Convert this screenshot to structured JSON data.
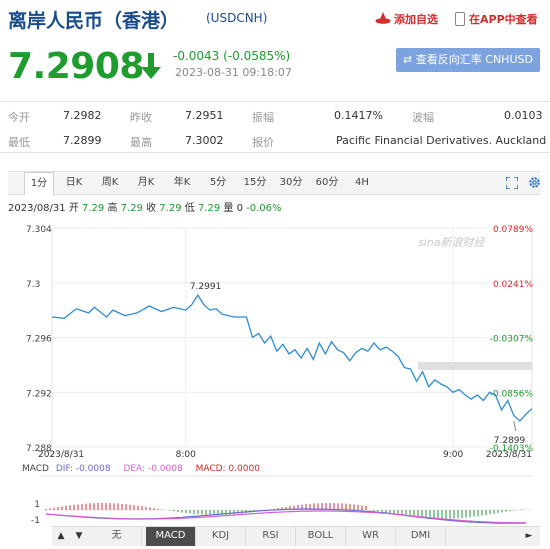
{
  "header": {
    "title": "离岸人民币（香港）",
    "code": "(USDCNH)",
    "add_fav_label": "添加自选",
    "app_view_label": "在APP中查看"
  },
  "quote": {
    "price": "7.2908",
    "change": "-0.0043 (-0.0585%)",
    "timestamp": "2023-08-31 09:18:07",
    "convert_label": "查看反向汇率 CNHUSD"
  },
  "stats": {
    "open_label": "今开",
    "open_value": "7.2982",
    "prev_close_label": "昨收",
    "prev_close_value": "7.2951",
    "amplitude_label": "振幅",
    "amplitude_value": "0.1417%",
    "volatility_label": "波幅",
    "volatility_value": "0.0103",
    "low_label": "最低",
    "low_value": "7.2899",
    "high_label": "最高",
    "high_value": "7.3002",
    "quoter_label": "报价",
    "quoter_value": "Pacific Financial Derivatives. Auckland"
  },
  "period_tabs": [
    "1分",
    "日K",
    "周K",
    "月K",
    "年K",
    "5分",
    "15分",
    "30分",
    "60分",
    "4H"
  ],
  "quote_line": {
    "date": "2023/08/31",
    "open_label": "开",
    "open": "7.29",
    "high_label": "高",
    "high": "7.29",
    "close_label": "收",
    "close": "7.29",
    "low_label": "低",
    "low": "7.29",
    "vol_label": "量",
    "vol": "0",
    "change": "-0.06%"
  },
  "macd": {
    "label": "MACD",
    "dif": "DIF: -0.0008",
    "dea": "DEA: -0.0008",
    "macd": "MACD: 0.0000"
  },
  "indicator_tabs": [
    "无",
    "MACD",
    "KDJ",
    "RSI",
    "BOLL",
    "WR",
    "DMI"
  ],
  "watermark": "sina新浪财经",
  "colors": {
    "up": "#d62c2c",
    "down": "#1e9c2e",
    "title": "#1a4c8c",
    "line": "#2e8bd6",
    "button": "#7da3de"
  },
  "chart_data": {
    "type": "line",
    "y_ticks": [
      "7.304",
      "7.3",
      "7.296",
      "7.292",
      "7.288"
    ],
    "y_range": [
      7.288,
      7.304
    ],
    "pct_ticks": [
      "0.0789%",
      "0.0241%",
      "-0.0307%",
      "-0.0856%",
      "-0.1403%"
    ],
    "x_ticks": [
      "2023/8/31",
      "8:00",
      "9:00",
      "2023/8/31"
    ],
    "annotations": [
      {
        "label": "7.2991",
        "x": 48,
        "y": 7.2991
      },
      {
        "label": "7.2899",
        "x": 152,
        "y": 7.2899
      }
    ],
    "x": [
      0,
      4,
      8,
      12,
      14,
      18,
      20,
      24,
      28,
      32,
      36,
      40,
      44,
      46,
      48,
      50,
      52,
      54,
      56,
      60,
      64,
      66,
      68,
      70,
      72,
      74,
      76,
      78,
      80,
      82,
      84,
      86,
      88,
      90,
      92,
      94,
      96,
      98,
      100,
      102,
      104,
      106,
      108,
      110,
      112,
      114,
      116,
      118,
      120,
      122,
      124,
      126,
      128,
      130,
      132,
      134,
      136,
      138,
      140,
      142,
      144,
      146,
      148,
      150,
      152,
      154,
      156,
      158
    ],
    "y": [
      7.2975,
      7.2974,
      7.2981,
      7.2978,
      7.2982,
      7.2975,
      7.298,
      7.2976,
      7.2978,
      7.2983,
      7.2979,
      7.2982,
      7.298,
      7.2984,
      7.2991,
      7.2984,
      7.298,
      7.2981,
      7.2977,
      7.2975,
      7.2975,
      7.296,
      7.2963,
      7.2956,
      7.2961,
      7.295,
      7.2955,
      7.2948,
      7.2951,
      7.2945,
      7.2952,
      7.2944,
      7.2956,
      7.2948,
      7.2957,
      7.2951,
      7.2949,
      7.2943,
      7.2949,
      7.2952,
      7.295,
      7.2956,
      7.2951,
      7.2953,
      7.295,
      7.2946,
      7.2938,
      7.2937,
      7.2928,
      7.2935,
      7.2924,
      7.2929,
      7.2926,
      7.2924,
      7.292,
      7.2922,
      7.2918,
      7.2915,
      7.2918,
      7.2914,
      7.292,
      7.2918,
      7.2907,
      7.2914,
      7.2903,
      7.2899,
      7.2904,
      7.2908
    ]
  }
}
